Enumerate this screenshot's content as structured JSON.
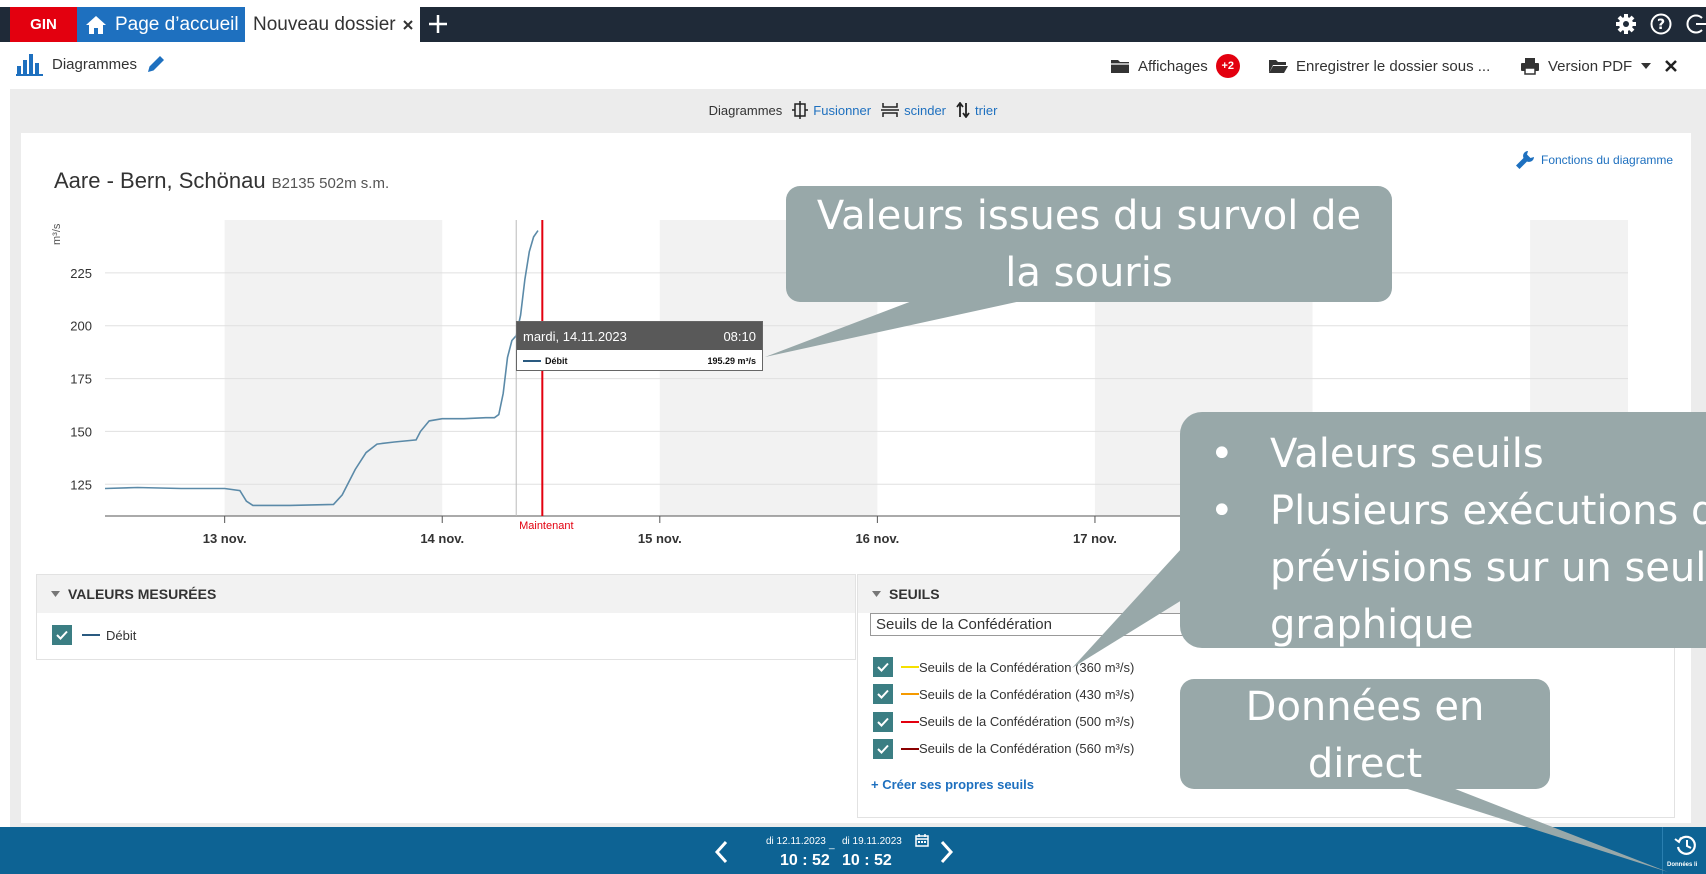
{
  "tabs": {
    "logo": "GIN",
    "home": "Page d’accueil",
    "active": "Nouveau dossier"
  },
  "toolbar": {
    "title": "Diagrammes",
    "affichages_label": "Affichages",
    "affichages_badge": "+2",
    "enregistrer_label": "Enregistrer le dossier sous ...",
    "pdf_label": "Version PDF"
  },
  "subbar": {
    "label": "Diagrammes",
    "fusionner": "Fusionner",
    "scinder": "scinder",
    "trier": "trier"
  },
  "chart_header": {
    "title": "Aare - Bern, Schönau",
    "subtitle": "B2135 502m  s.m.",
    "functions_link": "Fonctions du diagramme"
  },
  "chart_data": {
    "type": "line",
    "ylabel": "m³/s",
    "yticks": [
      125,
      150,
      175,
      200,
      225
    ],
    "ylim": [
      110,
      250
    ],
    "x_tick_labels": [
      "13 nov.",
      "14 nov.",
      "15 nov.",
      "16 nov.",
      "17 nov."
    ],
    "x_tick_days": [
      13,
      14,
      15,
      16,
      17
    ],
    "xlim_days": [
      12.45,
      19.45
    ],
    "now_label": "Maintenant",
    "now_day": 14.46,
    "hover_day": 14.34,
    "series": [
      {
        "name": "Débit",
        "color": "#5b8aa8",
        "x": [
          12.45,
          12.6,
          12.8,
          13.0,
          13.07,
          13.1,
          13.13,
          13.3,
          13.5,
          13.54,
          13.6,
          13.65,
          13.7,
          13.78,
          13.88,
          13.9,
          13.94,
          14.0,
          14.1,
          14.2,
          14.24,
          14.26,
          14.28,
          14.3,
          14.32,
          14.34,
          14.36,
          14.38,
          14.4,
          14.42,
          14.44
        ],
        "y": [
          123,
          123.5,
          123,
          123,
          122,
          117,
          115,
          115,
          115.5,
          120,
          132,
          140,
          144,
          145,
          146,
          150,
          155,
          156,
          156,
          156.5,
          156.5,
          158,
          168,
          185,
          193,
          195.3,
          205,
          222,
          235,
          242,
          245
        ]
      }
    ]
  },
  "tooltip": {
    "date": "mardi, 14.11.2023",
    "time": "08:10",
    "series_name": "Débit",
    "value": "195.29 m³/s"
  },
  "measured": {
    "header": "VALEURS MESURÉES",
    "item": "Débit"
  },
  "thresholds": {
    "header": "SEUILS",
    "select_value": "Seuils de la Confédération",
    "items": [
      {
        "label": "Seuils de la Confédération (360 m³/s)",
        "color": "#f5e000"
      },
      {
        "label": "Seuils de la Confédération (430 m³/s)",
        "color": "#f59a00"
      },
      {
        "label": "Seuils de la Confédération (500 m³/s)",
        "color": "#e3000f"
      },
      {
        "label": "Seuils de la Confédération (560 m³/s)",
        "color": "#8b0000"
      }
    ],
    "create_link": "+ Créer ses propres seuils"
  },
  "bottom": {
    "from_date": "di 12.11.2023",
    "to_date": "di 19.11.2023",
    "separator": "_",
    "from_time": "10 : 52",
    "to_time": "10 : 52",
    "live_label": "Données li"
  },
  "callouts": {
    "hover_line1": "Valeurs issues du survol de",
    "hover_line2": "la souris",
    "seuils_1": "Valeurs seuils",
    "seuils_2": "Plusieurs exécutions de",
    "seuils_3": "prévisions sur un seul",
    "seuils_4": "graphique",
    "live_line1": "Données en",
    "live_line2": "direct"
  },
  "colors": {
    "nav_dark": "#1f2a38",
    "brand_red": "#e3000f",
    "accent_blue": "#1e70bf",
    "bottom_bar": "#0d6394",
    "callout": "#98a8a9",
    "check": "#3b7e83"
  }
}
